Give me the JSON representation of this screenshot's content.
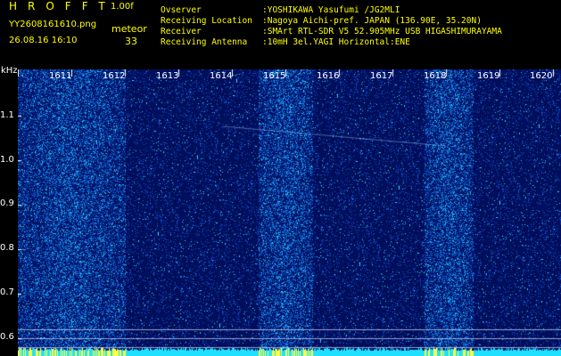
{
  "header": {
    "app_title": "HROFFT",
    "version": "1.00f",
    "filename": "YY2608161610.png",
    "timestamp": "26.08.16 16:10",
    "meteor_label": "meteor",
    "meteor_count": "33"
  },
  "info": {
    "rows": [
      {
        "label": "Ovserver",
        "value": ":YOSHIKAWA Yasufumi /JG2MLI"
      },
      {
        "label": "Receiving Location",
        "value": ":Nagoya Aichi-pref. JAPAN (136.90E, 35.20N)"
      },
      {
        "label": "Receiver",
        "value": ":SMArt RTL-SDR V5 52.905MHz USB HIGASHIMURAYAMA"
      },
      {
        "label": "Receiving Antenna",
        "value": ":10mH 3el.YAGI Horizontal:ENE"
      }
    ]
  },
  "chart_data": {
    "type": "heatmap",
    "ylabel": "kHz",
    "x_ticks": [
      "1611",
      "1612",
      "1613",
      "1614",
      "1615",
      "1616",
      "1617",
      "1618",
      "1619",
      "1620"
    ],
    "y_ticks": [
      "1.1",
      "1.0",
      "0.9",
      "0.8",
      "0.7",
      "0.6"
    ],
    "ylim": [
      0.575,
      1.175
    ],
    "bright_bands_minutes": [
      [
        1610,
        1612
      ],
      [
        1614.5,
        1615.5
      ],
      [
        1617.6,
        1618.5
      ]
    ],
    "colors": {
      "background": "#00005a",
      "signal": "#3060ff",
      "peak": "#00ffff"
    }
  },
  "colors": {
    "label_yellow": "#ffff00",
    "text_white": "#ffffff"
  }
}
